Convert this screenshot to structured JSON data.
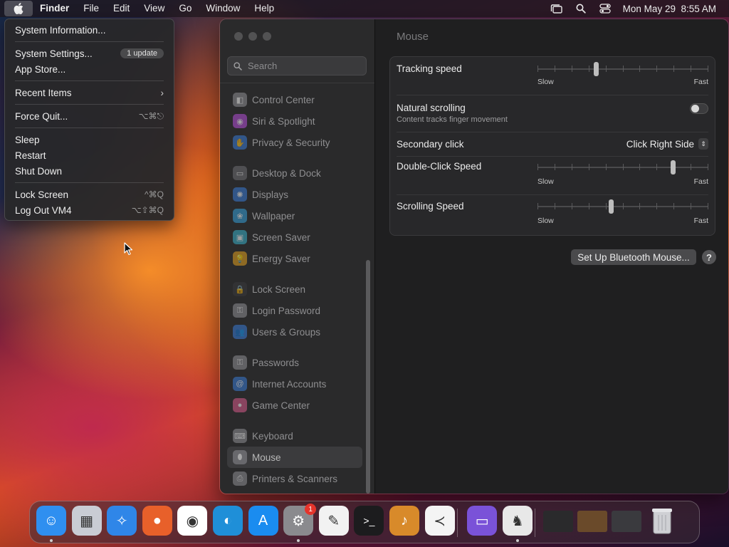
{
  "menubar": {
    "apple_icon": "apple-logo-icon",
    "items": [
      "Finder",
      "File",
      "Edit",
      "View",
      "Go",
      "Window",
      "Help"
    ],
    "status_icons": [
      "stage-manager-icon",
      "spotlight-search-icon",
      "control-center-icon"
    ],
    "clock": "Mon May 29  8:55 AM"
  },
  "apple_menu": {
    "system_information": "System Information...",
    "system_settings": "System Settings...",
    "update_badge": "1 update",
    "app_store": "App Store...",
    "recent_items": "Recent Items",
    "recent_chevron": "›",
    "force_quit": "Force Quit...",
    "force_quit_shortcut": "⌥⌘⎋",
    "sleep": "Sleep",
    "restart": "Restart",
    "shut_down": "Shut Down",
    "lock_screen": "Lock Screen",
    "lock_screen_shortcut": "^⌘Q",
    "log_out": "Log Out VM4",
    "log_out_shortcut": "⌥⇧⌘Q"
  },
  "settings": {
    "search_placeholder": "Search",
    "sidebar_groups": [
      [
        {
          "label": "Control Center",
          "icon": "control-center-icon",
          "color": "#8e8e93"
        },
        {
          "label": "Siri & Spotlight",
          "icon": "siri-icon",
          "color": "#b44fd8"
        },
        {
          "label": "Privacy & Security",
          "icon": "hand-icon",
          "color": "#3a7bd5"
        }
      ],
      [
        {
          "label": "Desktop & Dock",
          "icon": "dock-icon",
          "color": "#6e6e73"
        },
        {
          "label": "Displays",
          "icon": "sun-icon",
          "color": "#3a7bd5"
        },
        {
          "label": "Wallpaper",
          "icon": "wallpaper-icon",
          "color": "#35a0d8"
        },
        {
          "label": "Screen Saver",
          "icon": "screen-saver-icon",
          "color": "#3ab0c8"
        },
        {
          "label": "Energy Saver",
          "icon": "bulb-icon",
          "color": "#e0a020"
        }
      ],
      [
        {
          "label": "Lock Screen",
          "icon": "lock-icon",
          "color": "#3a3a3c"
        },
        {
          "label": "Login Password",
          "icon": "key-icon",
          "color": "#8e8e93"
        },
        {
          "label": "Users & Groups",
          "icon": "users-icon",
          "color": "#3a7bd5"
        }
      ],
      [
        {
          "label": "Passwords",
          "icon": "key-icon",
          "color": "#8e8e93"
        },
        {
          "label": "Internet Accounts",
          "icon": "at-icon",
          "color": "#3a7bd5"
        },
        {
          "label": "Game Center",
          "icon": "game-center-icon",
          "color": "#d85a8a"
        }
      ],
      [
        {
          "label": "Keyboard",
          "icon": "keyboard-icon",
          "color": "#8e8e93"
        },
        {
          "label": "Mouse",
          "icon": "mouse-icon",
          "color": "#8e8e93",
          "selected": true
        },
        {
          "label": "Printers & Scanners",
          "icon": "printer-icon",
          "color": "#8e8e93"
        }
      ]
    ],
    "page_title": "Mouse",
    "tracking_speed": {
      "label": "Tracking speed",
      "slow": "Slow",
      "fast": "Fast",
      "value": 0.34
    },
    "natural_scrolling": {
      "label": "Natural scrolling",
      "sublabel": "Content tracks finger movement",
      "enabled": false
    },
    "secondary_click": {
      "label": "Secondary click",
      "value": "Click Right Side"
    },
    "double_click_speed": {
      "label": "Double-Click Speed",
      "slow": "Slow",
      "fast": "Fast",
      "value": 0.79
    },
    "scrolling_speed": {
      "label": "Scrolling Speed",
      "slow": "Slow",
      "fast": "Fast",
      "value": 0.43
    },
    "bluetooth_button": "Set Up Bluetooth Mouse...",
    "help_button": "?"
  },
  "dock": {
    "apps": [
      {
        "name": "finder",
        "icon": "finder-icon",
        "color": "#2f8ff0",
        "glyph": "☺",
        "running": true
      },
      {
        "name": "launchpad",
        "icon": "launchpad-icon",
        "color": "#c9ccd4",
        "glyph": "▦",
        "running": false
      },
      {
        "name": "safari",
        "icon": "safari-icon",
        "color": "#2f86e8",
        "glyph": "✧",
        "running": false
      },
      {
        "name": "firefox",
        "icon": "firefox-icon",
        "color": "#e8602a",
        "glyph": "●",
        "running": false
      },
      {
        "name": "chrome",
        "icon": "chrome-icon",
        "color": "#ffffff",
        "glyph": "◉",
        "running": false
      },
      {
        "name": "edge",
        "icon": "edge-icon",
        "color": "#1f8fd8",
        "glyph": "◐",
        "running": false
      },
      {
        "name": "app-store",
        "icon": "app-store-icon",
        "color": "#1a8cf0",
        "glyph": "A",
        "running": false
      },
      {
        "name": "system-settings",
        "icon": "system-settings-icon",
        "color": "#8a8a8e",
        "glyph": "⚙",
        "running": true,
        "badge": "1"
      },
      {
        "name": "textedit",
        "icon": "textedit-icon",
        "color": "#f2f2f2",
        "glyph": "✎",
        "running": false
      },
      {
        "name": "terminal",
        "icon": "terminal-icon",
        "color": "#1c1c1e",
        "glyph": ">_",
        "running": false
      },
      {
        "name": "garageband",
        "icon": "garageband-icon",
        "color": "#d88a2a",
        "glyph": "♪",
        "running": false
      },
      {
        "name": "vscode",
        "icon": "vscode-icon",
        "color": "#f4f4f4",
        "glyph": "≺",
        "running": false
      },
      {
        "name": "remote-app",
        "icon": "remote-app-icon",
        "color": "#7a52d8",
        "glyph": "▭",
        "running": false
      },
      {
        "name": "chess",
        "icon": "chess-icon",
        "color": "#e8e8e8",
        "glyph": "♞",
        "running": true
      }
    ],
    "minimized": [
      {
        "name": "minimized-window-1",
        "icon": "minimized-window-icon",
        "color": "#2a2a2c"
      },
      {
        "name": "minimized-window-2",
        "icon": "minimized-window-icon",
        "color": "#6a4a2a"
      },
      {
        "name": "minimized-window-3",
        "icon": "minimized-window-icon",
        "color": "#3a3a3e"
      }
    ],
    "trash": {
      "name": "trash",
      "icon": "trash-icon",
      "color": "#c8c8cc"
    }
  }
}
